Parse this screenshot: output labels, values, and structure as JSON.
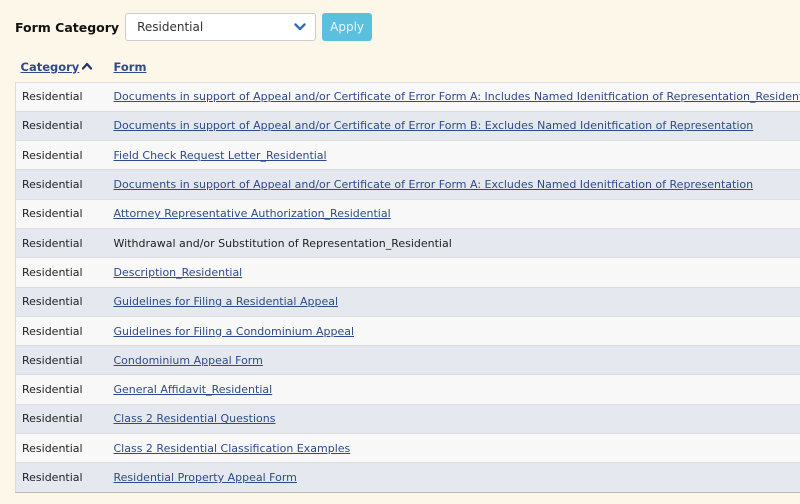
{
  "filter": {
    "label": "Form Category",
    "selected": "Residential",
    "apply_label": "Apply"
  },
  "table": {
    "headers": {
      "category": "Category",
      "form": "Form"
    },
    "rows": [
      {
        "category": "Residential",
        "form": "Documents in support of Appeal and/or Certificate of Error Form A: Includes Named Idenitfication of Representation_Residential",
        "link": true
      },
      {
        "category": "Residential",
        "form": "Documents in support of Appeal and/or Certificate of Error Form B: Excludes Named Idenitfication of Representation",
        "link": true
      },
      {
        "category": "Residential",
        "form": "Field Check Request Letter_Residential",
        "link": true
      },
      {
        "category": "Residential",
        "form": "Documents in support of Appeal and/or Certificate of Error Form A: Excludes Named Idenitfication of Representation",
        "link": true
      },
      {
        "category": "Residential",
        "form": "Attorney Representative Authorization_Residential",
        "link": true
      },
      {
        "category": "Residential",
        "form": "Withdrawal and/or Substitution of Representation_Residential",
        "link": false
      },
      {
        "category": "Residential",
        "form": "Description_Residential",
        "link": true
      },
      {
        "category": "Residential",
        "form": "Guidelines for Filing a Residential Appeal",
        "link": true
      },
      {
        "category": "Residential",
        "form": "Guidelines for Filing a Condominium Appeal",
        "link": true
      },
      {
        "category": "Residential",
        "form": "Condominium Appeal Form",
        "link": true
      },
      {
        "category": "Residential",
        "form": "General Affidavit_Residential",
        "link": true
      },
      {
        "category": "Residential",
        "form": "Class 2 Residential Questions",
        "link": true
      },
      {
        "category": "Residential",
        "form": "Class 2 Residential Classification Examples",
        "link": true
      },
      {
        "category": "Residential",
        "form": "Residential Property Appeal Form",
        "link": true
      }
    ]
  },
  "colors": {
    "background": "#fdf7ea",
    "link": "#2e4a8a",
    "apply_button": "#5bc0de",
    "row_even": "#e5e8ef",
    "row_odd": "#f8f8f8"
  },
  "icons": {
    "select": "chevron-down-icon",
    "sort": "sort-ascending-icon"
  }
}
